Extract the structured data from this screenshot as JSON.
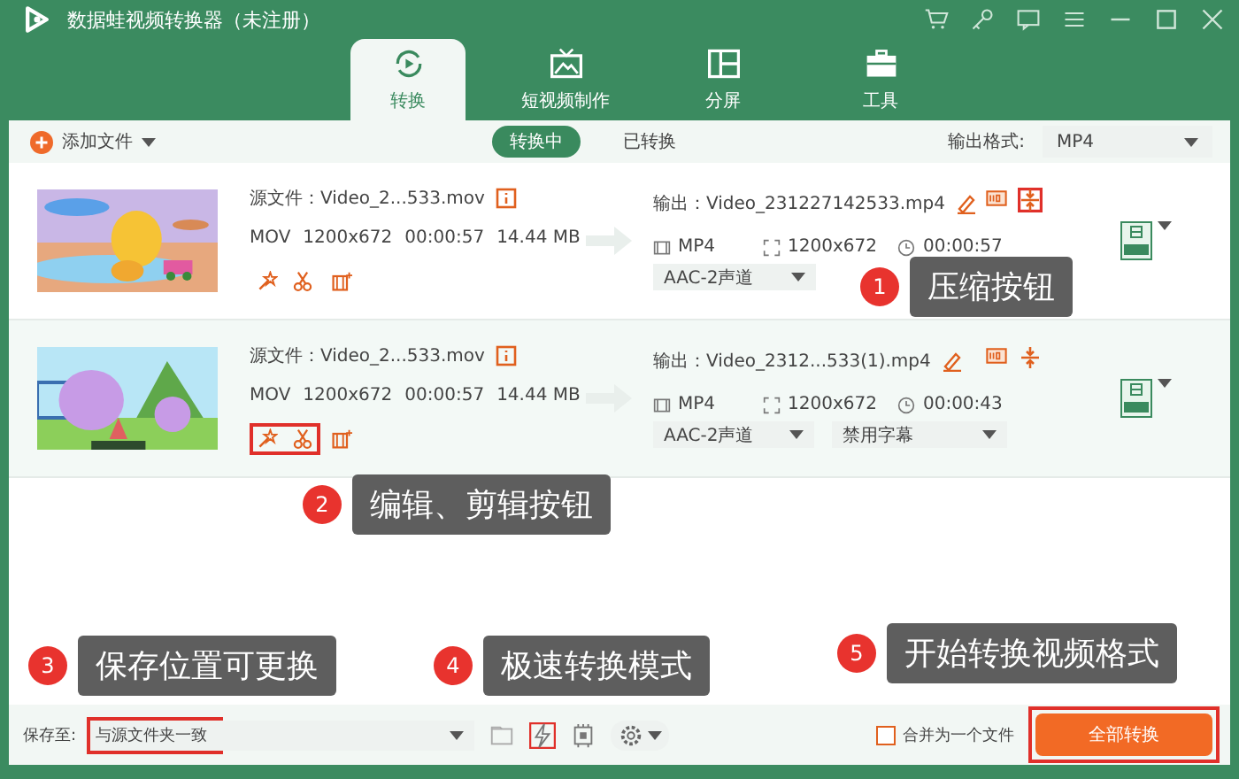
{
  "window": {
    "title": "数据蛙视频转换器（未注册）"
  },
  "tabs": [
    {
      "label": "转换",
      "selected": true
    },
    {
      "label": "短视频制作",
      "selected": false
    },
    {
      "label": "分屏",
      "selected": false
    },
    {
      "label": "工具",
      "selected": false
    }
  ],
  "toolbar": {
    "add_button": "添加文件",
    "filters": [
      {
        "label": "转换中",
        "selected": true
      },
      {
        "label": "已转换",
        "selected": false
      }
    ],
    "format_label": "输出格式:",
    "format_value": "MP4"
  },
  "files": [
    {
      "selected": false,
      "source": "源文件：Video_2...533.mov",
      "meta": [
        "MOV",
        "1200x672",
        "00:00:57",
        "14.44 MB"
      ],
      "edit_highlighted": false,
      "output": "输出：Video_231227142533.mp4",
      "compress_highlighted": true,
      "format": "MP4",
      "resolution": "1200x672",
      "duration": "00:00:57",
      "audio": "AAC-2声道"
    },
    {
      "selected": true,
      "source": "源文件：Video_2...533.mov",
      "meta": [
        "MOV",
        "1200x672",
        "00:00:57",
        "14.44 MB"
      ],
      "edit_highlighted": true,
      "output": "输出：Video_2312...533(1).mp4",
      "compress_highlighted": false,
      "format": "MP4",
      "resolution": "1200x672",
      "duration": "00:00:43",
      "audio": "AAC-2声道",
      "subtitle": "禁用字幕"
    }
  ],
  "bottom": {
    "save_label": "保存至:",
    "save_path": "与源文件夹一致",
    "save_highlighted": true,
    "speed_highlighted": true,
    "merge": {
      "label": "合并为一个文件",
      "checked": false
    },
    "convert_button": "全部转换",
    "convert_highlighted": true
  },
  "callouts": [
    {
      "number": "1",
      "text": "压缩按钮"
    },
    {
      "number": "2",
      "text": "编辑、剪辑按钮"
    },
    {
      "number": "3",
      "text": "保存位置可更换"
    },
    {
      "number": "4",
      "text": "极速转换模式"
    },
    {
      "number": "5",
      "text": "开始转换视频格式"
    }
  ]
}
